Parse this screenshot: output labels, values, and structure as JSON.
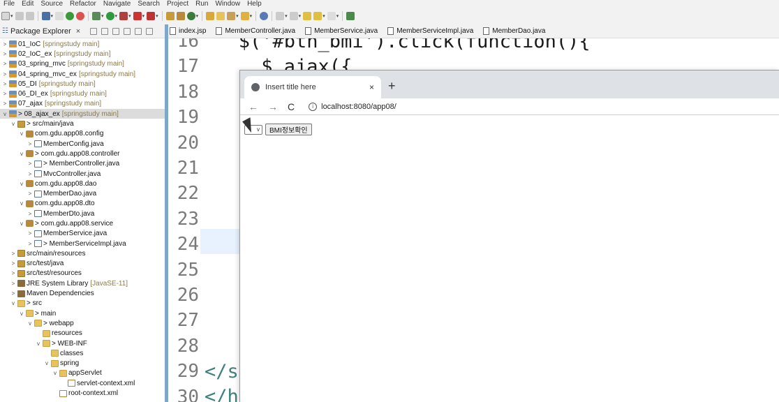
{
  "menu": [
    "File",
    "Edit",
    "Source",
    "Refactor",
    "Navigate",
    "Search",
    "Project",
    "Run",
    "Window",
    "Help"
  ],
  "explorer": {
    "tab_label": "Package Explorer",
    "close_glyph": "×",
    "rows": [
      {
        "arrow": ">",
        "icon": "proj",
        "label": "01_IoC",
        "tag": "[springstudy main]"
      },
      {
        "arrow": ">",
        "icon": "proj",
        "label": "02_IoC_ex",
        "tag": "[springstudy main]"
      },
      {
        "arrow": ">",
        "icon": "proj",
        "label": "03_spring_mvc",
        "tag": "[springstudy main]"
      },
      {
        "arrow": ">",
        "icon": "proj",
        "label": "04_spring_mvc_ex",
        "tag": "[springstudy main]"
      },
      {
        "arrow": ">",
        "icon": "proj",
        "label": "05_DI",
        "tag": "[springstudy main]"
      },
      {
        "arrow": ">",
        "icon": "proj",
        "label": "06_DI_ex",
        "tag": "[springstudy main]"
      },
      {
        "arrow": ">",
        "icon": "proj",
        "label": "07_ajax",
        "tag": "[springstudy main]"
      },
      {
        "arrow": "v",
        "icon": "proj",
        "label": "> 08_ajax_ex",
        "tag": "[springstudy main]",
        "selected": true
      },
      {
        "arrow": "v",
        "icon": "srcf",
        "label": "> src/main/java",
        "indent": 1
      },
      {
        "arrow": "v",
        "icon": "pkg",
        "label": "com.gdu.app08.config",
        "indent": 2
      },
      {
        "arrow": ">",
        "icon": "java",
        "label": "MemberConfig.java",
        "indent": 3
      },
      {
        "arrow": "v",
        "icon": "pkg",
        "label": "> com.gdu.app08.controller",
        "indent": 2
      },
      {
        "arrow": ">",
        "icon": "java",
        "label": "> MemberController.java",
        "indent": 3
      },
      {
        "arrow": ">",
        "icon": "java",
        "label": "MvcController.java",
        "indent": 3
      },
      {
        "arrow": "v",
        "icon": "pkg",
        "label": "com.gdu.app08.dao",
        "indent": 2
      },
      {
        "arrow": ">",
        "icon": "java",
        "label": "MemberDao.java",
        "indent": 3
      },
      {
        "arrow": "v",
        "icon": "pkg",
        "label": "com.gdu.app08.dto",
        "indent": 2
      },
      {
        "arrow": ">",
        "icon": "java",
        "label": "MemberDto.java",
        "indent": 3
      },
      {
        "arrow": "v",
        "icon": "pkg",
        "label": "> com.gdu.app08.service",
        "indent": 2
      },
      {
        "arrow": ">",
        "icon": "java",
        "label": "MemberService.java",
        "indent": 3
      },
      {
        "arrow": ">",
        "icon": "java",
        "label": "> MemberServiceImpl.java",
        "indent": 3
      },
      {
        "arrow": ">",
        "icon": "srcf",
        "label": "src/main/resources",
        "indent": 1
      },
      {
        "arrow": ">",
        "icon": "srcf",
        "label": "src/test/java",
        "indent": 1
      },
      {
        "arrow": ">",
        "icon": "srcf",
        "label": "src/test/resources",
        "indent": 1
      },
      {
        "arrow": ">",
        "icon": "lib",
        "label": "JRE System Library",
        "tag": "[JavaSE-11]",
        "indent": 1
      },
      {
        "arrow": ">",
        "icon": "lib",
        "label": "Maven Dependencies",
        "indent": 1
      },
      {
        "arrow": "v",
        "icon": "folder",
        "label": "> src",
        "indent": 1
      },
      {
        "arrow": "v",
        "icon": "folder",
        "label": "> main",
        "indent": 2
      },
      {
        "arrow": "v",
        "icon": "folder",
        "label": "> webapp",
        "indent": 3
      },
      {
        "arrow": "",
        "icon": "folder",
        "label": "resources",
        "indent": 4
      },
      {
        "arrow": "v",
        "icon": "folder",
        "label": "> WEB-INF",
        "indent": 4
      },
      {
        "arrow": "",
        "icon": "folder",
        "label": "classes",
        "indent": 5
      },
      {
        "arrow": "v",
        "icon": "folder",
        "label": "spring",
        "indent": 5
      },
      {
        "arrow": "v",
        "icon": "folder",
        "label": "appServlet",
        "indent": 6
      },
      {
        "arrow": "",
        "icon": "xml",
        "label": "servlet-context.xml",
        "indent": 7
      },
      {
        "arrow": "",
        "icon": "xml",
        "label": "root-context.xml",
        "indent": 6
      }
    ]
  },
  "editor": {
    "tabs": [
      "index.jsp",
      "MemberController.java",
      "MemberService.java",
      "MemberServiceImpl.java",
      "MemberDao.java"
    ],
    "lines": [
      {
        "n": "16",
        "code": "   $('#btn_bmi').click(function(){"
      },
      {
        "n": "17",
        "code": "     $.ajax({"
      },
      {
        "n": "18",
        "code": ""
      },
      {
        "n": "19",
        "code": ""
      },
      {
        "n": "20",
        "code": ""
      },
      {
        "n": "21",
        "code": ""
      },
      {
        "n": "22",
        "code": ""
      },
      {
        "n": "23",
        "code": ""
      },
      {
        "n": "24",
        "code": ""
      },
      {
        "n": "25",
        "code": ""
      },
      {
        "n": "26",
        "code": ""
      },
      {
        "n": "27",
        "code": ""
      },
      {
        "n": "28",
        "code": "   }"
      },
      {
        "n": "29",
        "code": "</sc"
      },
      {
        "n": "30",
        "code": "</he"
      }
    ]
  },
  "browser": {
    "tab_title": "Insert title here",
    "close_glyph": "×",
    "new_tab_glyph": "+",
    "back_glyph": "←",
    "forward_glyph": "→",
    "reload_glyph": "C",
    "url": "localhost:8080/app08/",
    "select_glyph": "v",
    "button_label": "BMI정보확인"
  }
}
